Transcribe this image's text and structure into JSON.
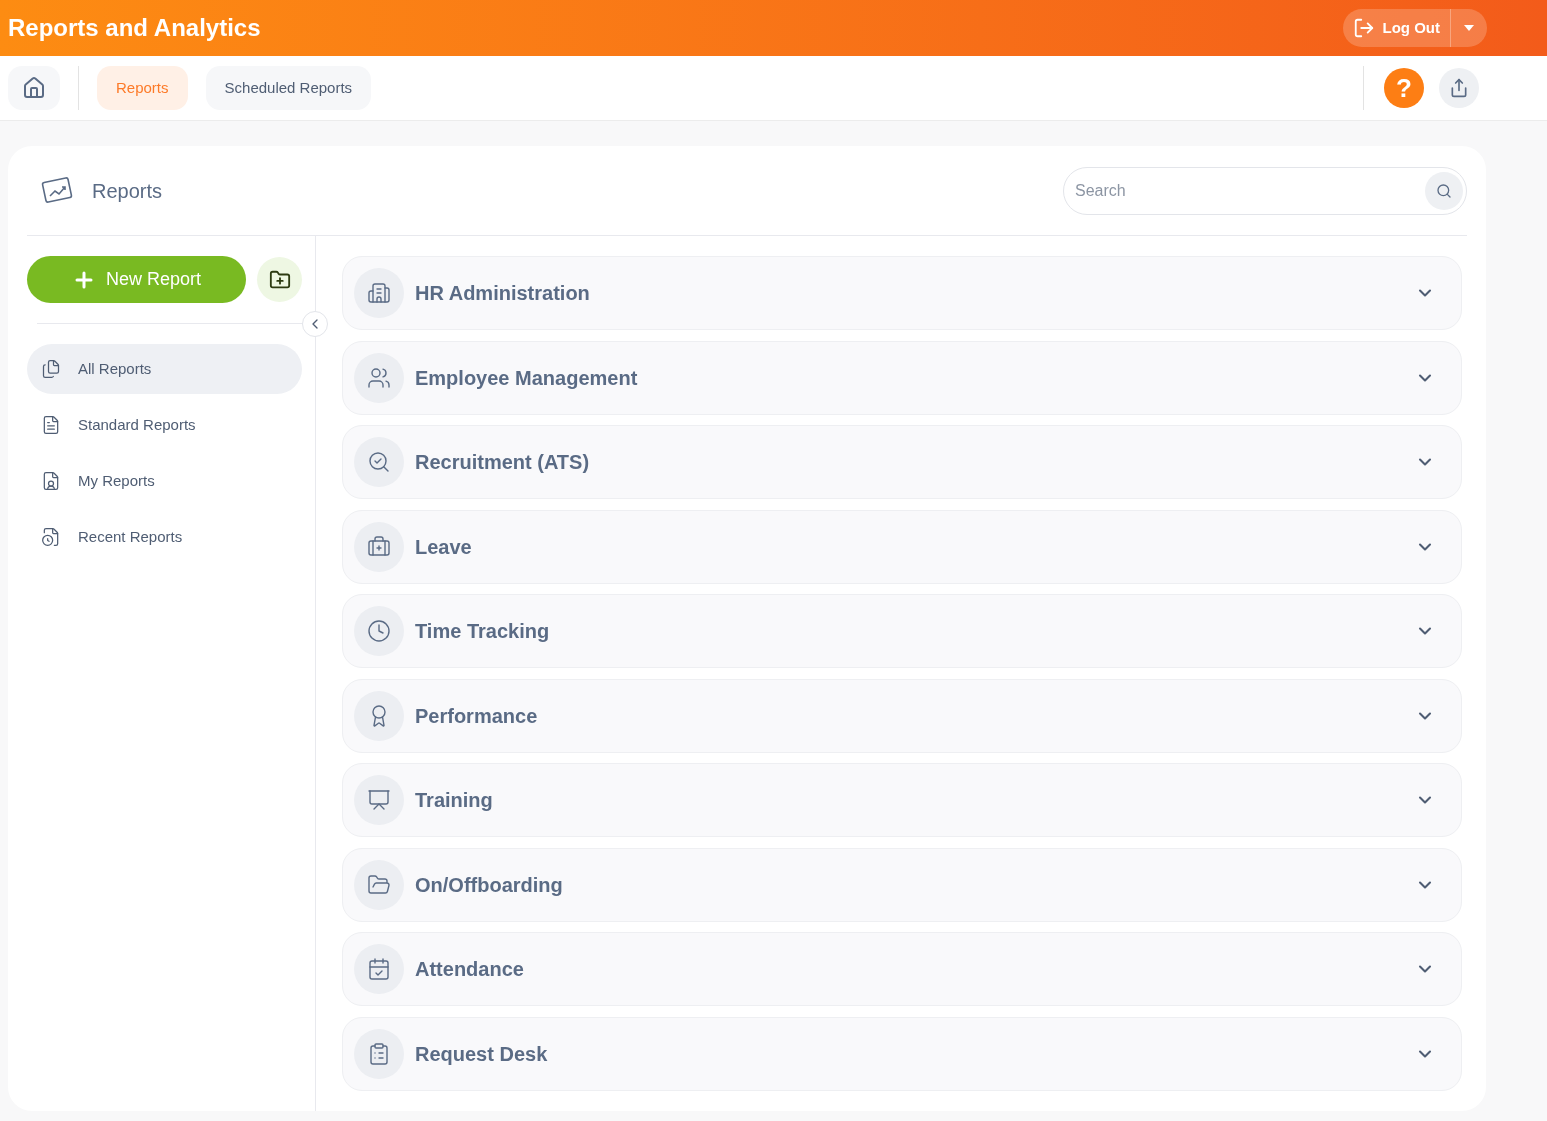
{
  "header": {
    "title": "Reports and Analytics",
    "logout_button": "Log Out",
    "help_button": "?"
  },
  "tabs": [
    {
      "label": "Reports",
      "selected": true
    },
    {
      "label": "Scheduled Reports",
      "selected": false
    }
  ],
  "panel": {
    "title": "Reports",
    "search": {
      "placeholder": "Search"
    }
  },
  "new_report_button": "New Report",
  "sidebar": {
    "items": [
      {
        "label": "All Reports",
        "selected": true
      },
      {
        "label": "Standard Reports",
        "selected": false
      },
      {
        "label": "My Reports",
        "selected": false
      },
      {
        "label": "Recent Reports",
        "selected": false
      }
    ]
  },
  "categories": [
    {
      "label": "HR Administration",
      "expanded": false
    },
    {
      "label": "Employee Management",
      "expanded": false
    },
    {
      "label": "Recruitment (ATS)",
      "expanded": false
    },
    {
      "label": "Leave",
      "expanded": false
    },
    {
      "label": "Time Tracking",
      "expanded": false
    },
    {
      "label": "Performance",
      "expanded": false
    },
    {
      "label": "Training",
      "expanded": false
    },
    {
      "label": "On/Offboarding",
      "expanded": false
    },
    {
      "label": "Attendance",
      "expanded": false
    },
    {
      "label": "Request Desk",
      "expanded": false
    }
  ]
}
